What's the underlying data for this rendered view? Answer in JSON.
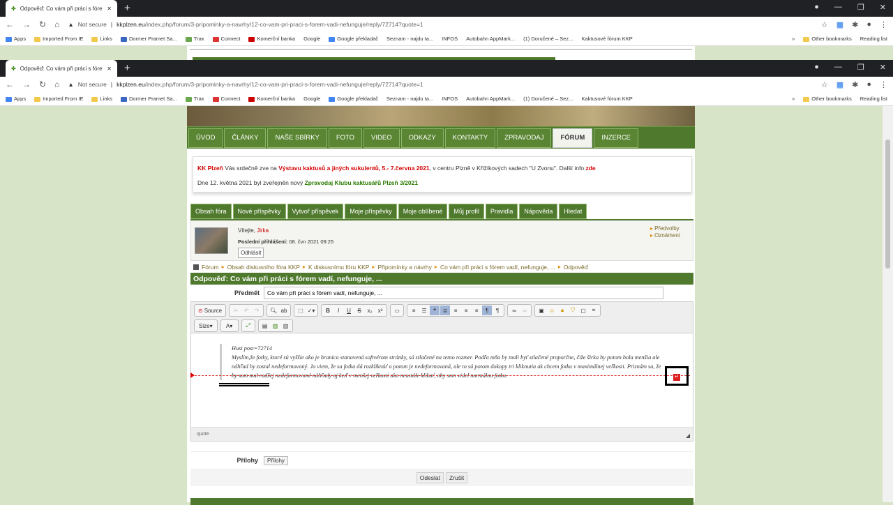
{
  "browser": {
    "tab_title": "Odpověď: Co vám při práci s fórem",
    "new_tab": "+",
    "url_not_secure": "Not secure",
    "url_domain": "kkplzen.eu",
    "url_path": "/index.php/forum/3-pripominky-a-navrhy/12-co-vam-pri-praci-s-forem-vadi-nefunguje/reply/72714?quote=1",
    "bookmarks": [
      "Apps",
      "Imported From IE",
      "Links",
      "Dormer Pramet Sa...",
      "Trax",
      "Connect",
      "Komerční banka",
      "Google",
      "Google překladač",
      "Seznam - najdu ta...",
      "INFOS",
      "Autobahn AppMark...",
      "(1) Doručené – Sez...",
      "Kaktusové fórum KKP"
    ],
    "bookmarks_more": "»",
    "other_bookmarks": "Other bookmarks",
    "reading_list": "Reading list"
  },
  "nav": {
    "items": [
      "ÚVOD",
      "ČLÁNKY",
      "NAŠE SBÍRKY",
      "FOTO",
      "VIDEO",
      "ODKAZY",
      "KONTAKTY",
      "ZPRAVODAJ",
      "FÓRUM",
      "INZERCE"
    ],
    "active": "FÓRUM"
  },
  "announce": {
    "kk": "KK Plzeň",
    "t1": " Vás srdečně zve na ",
    "event": "Výstavu kaktusů a jiných sukulentů, 5.- 7.června 2021",
    "t2": ", v centru Plzně v Křižíkových sadech \"U Zvonu\". Další info ",
    "here": "zde",
    "l2a": "Dne 12. května 2021 byl zveřejněn nový ",
    "l2b": "Zpravodaj Klubu kaktusářů Plzeň 3/2021"
  },
  "forum_tabs": [
    "Obsah fóra",
    "Nové příspěvky",
    "Vytvoř příspěvek",
    "Moje příspěvky",
    "Moje oblíbené",
    "Můj profil",
    "Pravidla",
    "Nápověda",
    "Hledat"
  ],
  "user": {
    "welcome": "Vítejte, ",
    "name": "Jirka",
    "last_login_label": "Poslední přihlášení:",
    "last_login": " 08. čvn 2021 09:25",
    "logout": "Odhlásit",
    "links": [
      "Předvolby",
      "Oznámení"
    ]
  },
  "breadcrumb": [
    "Fórum",
    "Obsah diskusního fóra KKP",
    "K diskusnímu fóru KKP",
    "Připomínky a návrhy",
    "Co vám při práci s fórem vadí, nefunguje, ...",
    "Odpověď"
  ],
  "reply_title": "Odpověď: Co vám při práci s fórem vadí, nefunguje, ...",
  "subject": {
    "label": "Předmět",
    "value": "Co vám při práci s fórem vadí, nefunguje, ..."
  },
  "editor": {
    "source": "Source",
    "size": "Size",
    "quote_head": "Husi post=72714",
    "quote_body": "Myslím,že fotky, ktoré sú vyššie ako je hranica stanovená softvérom stránky, sú stlačené na tento rozmer. Podľa mňa by mali byť stlačené proporčne, čiže širka by potom bola menšia ale náhľad by zostal nedeformovaný. Ja viem, že sa fotka dá rozkliknúť a potom je nedeformovaná, ale to sú potom dokopy tri kliknutia ak chcem fotku v maximálnej veľkosti. Priznám sa, že by som mal radšej nedeformované náhľady aj keď v menšej veľkosti ako neustále klikať, aby som videl normálnu fotku.",
    "footer_path": "quote"
  },
  "attachments": {
    "label": "Přílohy",
    "button": "Přílohy"
  },
  "buttons": {
    "submit": "Odeslat",
    "cancel": "Zrušit"
  }
}
